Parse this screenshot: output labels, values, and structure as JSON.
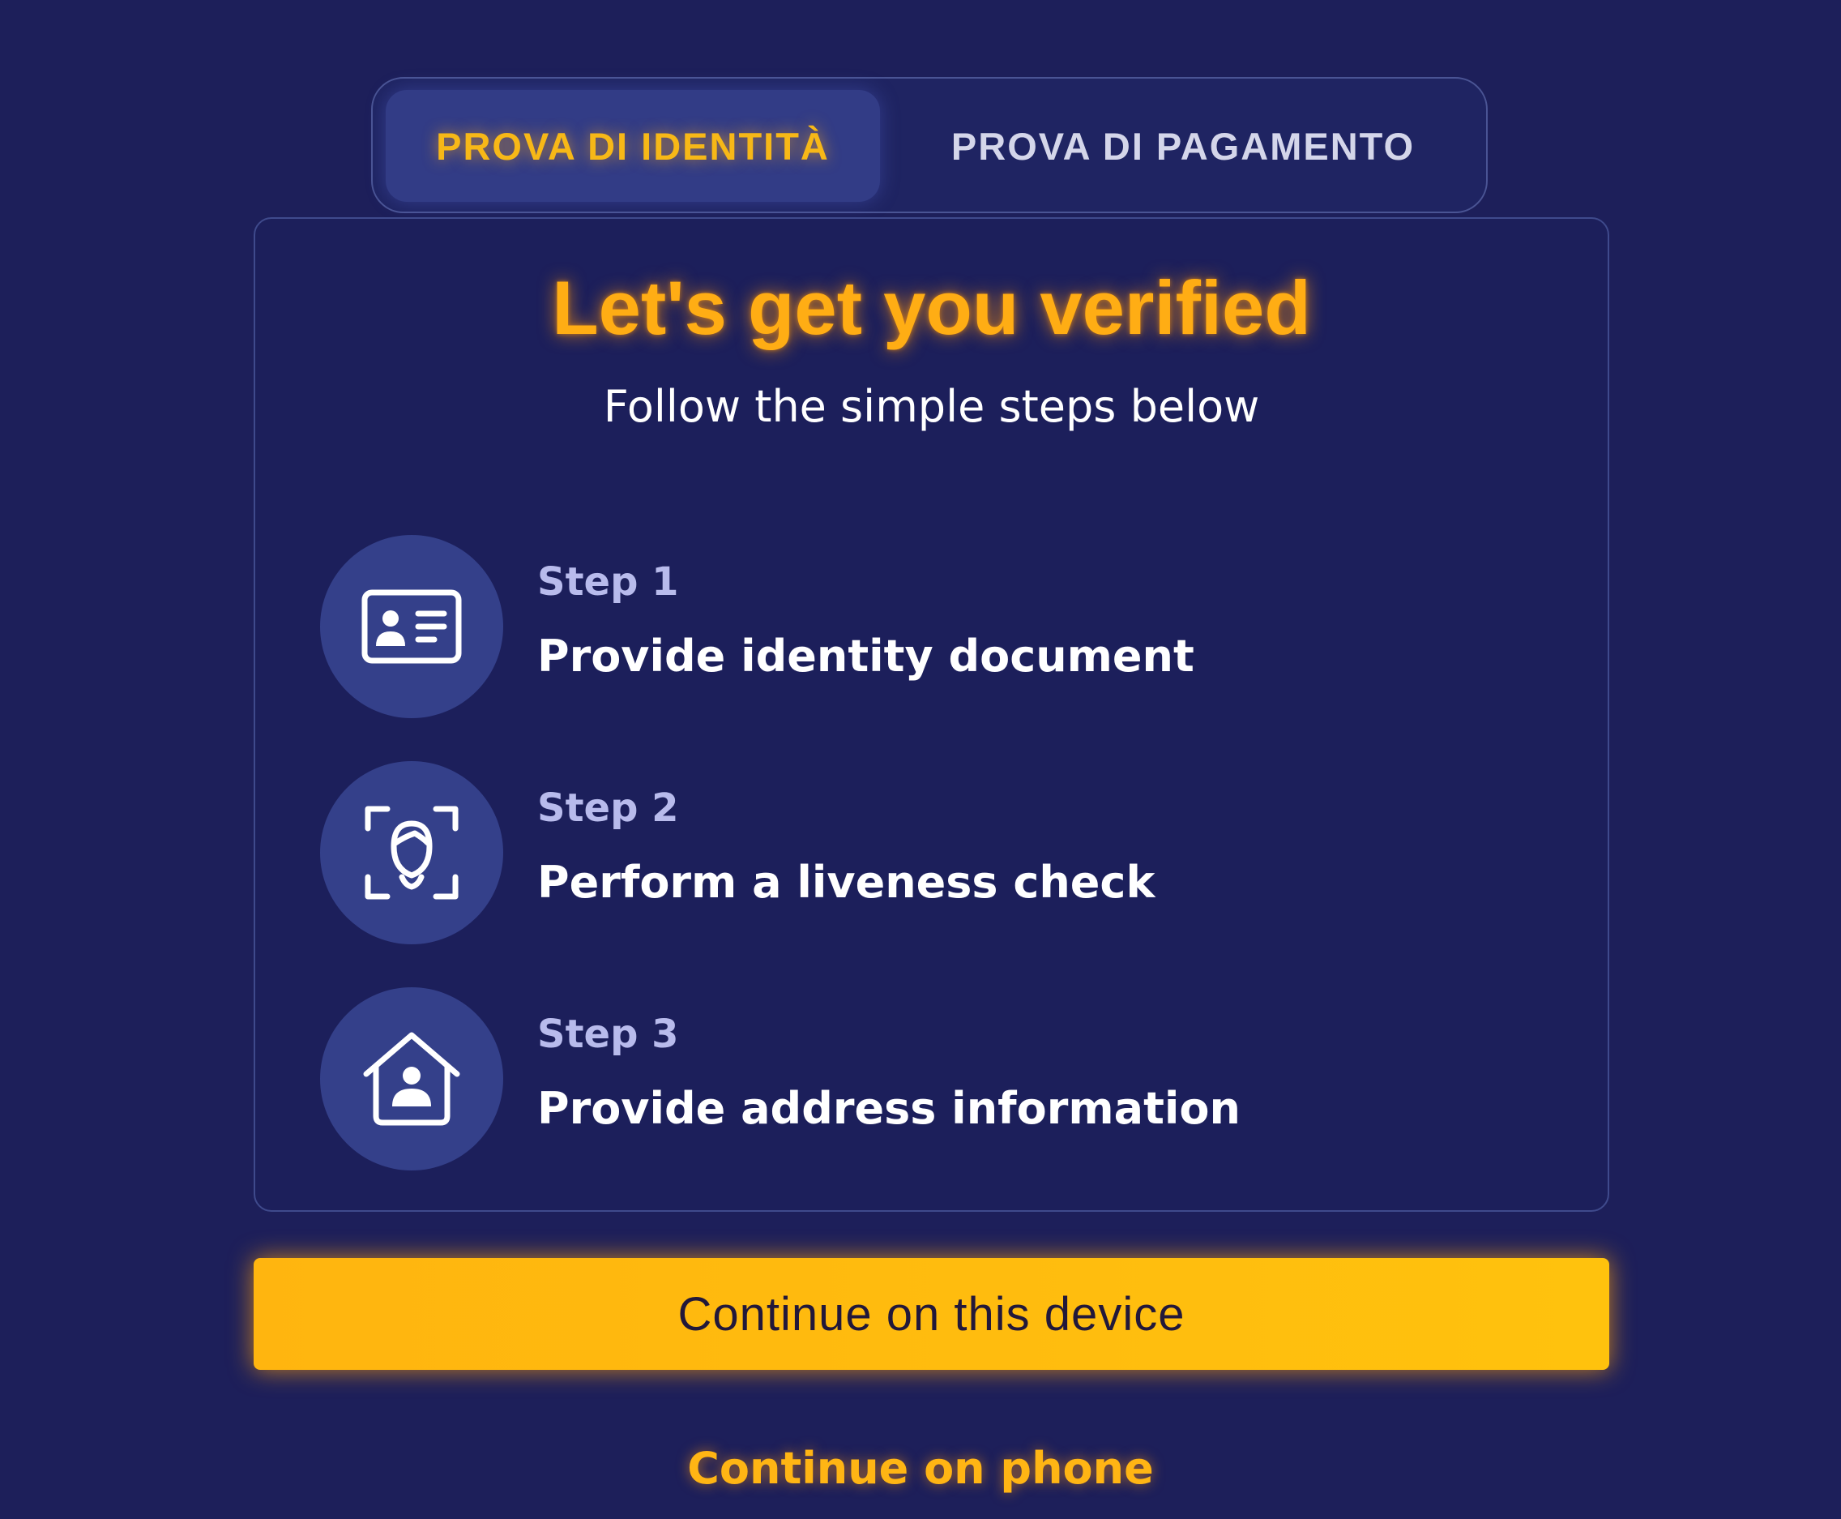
{
  "tabs": [
    {
      "label": "PROVA DI IDENTITÀ",
      "active": true
    },
    {
      "label": "PROVA DI PAGAMENTO",
      "active": false
    }
  ],
  "card": {
    "title": "Let's get you verified",
    "subtitle": "Follow the simple steps below",
    "steps": [
      {
        "label": "Step 1",
        "description": "Provide identity document",
        "icon": "id-card-icon"
      },
      {
        "label": "Step 2",
        "description": "Perform a liveness check",
        "icon": "face-scan-icon"
      },
      {
        "label": "Step 3",
        "description": "Provide address information",
        "icon": "home-user-icon"
      }
    ]
  },
  "actions": {
    "primary_label": "Continue on this device",
    "secondary_label": "Continue on phone"
  },
  "colors": {
    "background": "#1d1f5a",
    "accent": "#ffad14",
    "button": "#ffbc0f",
    "icon_circle": "#34408a"
  }
}
